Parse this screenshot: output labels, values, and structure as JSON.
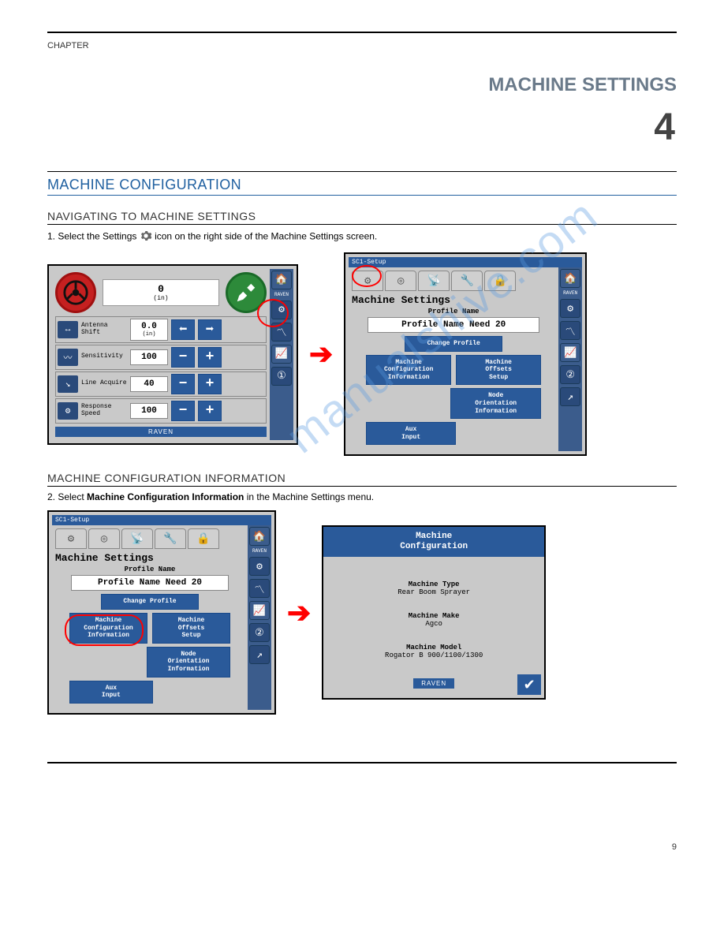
{
  "page": {
    "chapter_label": "CHAPTER",
    "chapter_title": "MACHINE SETTINGS",
    "chapter_number": "4",
    "section_heading": "MACHINE CONFIGURATION",
    "sub_heading_1": "NAVIGATING TO MACHINE SETTINGS",
    "step1_prefix": "1. Select the Settings ",
    "step1_suffix": " icon on the right side of the Machine Settings screen.",
    "sub_heading_2": "MACHINE CONFIGURATION INFORMATION",
    "step2_prefix": "2. Select ",
    "step2_bold": "Machine Configuration Information",
    "step2_suffix": " in the Machine Settings menu.",
    "footer_page": "9",
    "watermark": "manualshive.com"
  },
  "brand": "RAVEN",
  "screen1": {
    "top_value": "0",
    "top_unit": "(in)",
    "params": [
      {
        "label": "Antenna Shift",
        "value": "0.0",
        "unit": "(in)",
        "buttons": [
          "left",
          "right"
        ]
      },
      {
        "label": "Sensitivity",
        "value": "100",
        "unit": "",
        "buttons": [
          "minus",
          "plus"
        ]
      },
      {
        "label": "Line Acquire",
        "value": "40",
        "unit": "",
        "buttons": [
          "minus",
          "plus"
        ]
      },
      {
        "label": "Response Speed",
        "value": "100",
        "unit": "",
        "buttons": [
          "minus",
          "plus"
        ]
      }
    ]
  },
  "screen2": {
    "title_bar": "SC1-Setup",
    "heading": "Machine Settings",
    "profile_label": "Profile Name",
    "profile_value": "Profile Name Need 20",
    "change_profile": "Change Profile",
    "buttons": {
      "mci": "Machine\nConfiguration\nInformation",
      "mos": "Machine\nOffsets\nSetup",
      "noi": "Node\nOrientation\nInformation",
      "aux": "Aux\nInput"
    }
  },
  "screen3": {
    "title_bar": "SC1-Setup",
    "heading": "Machine Settings",
    "profile_label": "Profile Name",
    "profile_value": "Profile Name Need 20",
    "change_profile": "Change Profile",
    "buttons": {
      "mci": "Machine\nConfiguration\nInformation",
      "mos": "Machine\nOffsets\nSetup",
      "noi": "Node\nOrientation\nInformation",
      "aux": "Aux\nInput"
    }
  },
  "mc_panel": {
    "heading": "Machine\nConfiguration",
    "type_label": "Machine Type",
    "type_value": "Rear Boom Sprayer",
    "make_label": "Machine Make",
    "make_value": "Agco",
    "model_label": "Machine Model",
    "model_value": "Rogator B 900/1100/1300"
  },
  "side_icons": {
    "home": "home-icon",
    "gear": "gear-icon",
    "pulse": "pulse-icon",
    "trend": "trend-icon",
    "steps": "steps-icon",
    "link": "link-icon"
  }
}
